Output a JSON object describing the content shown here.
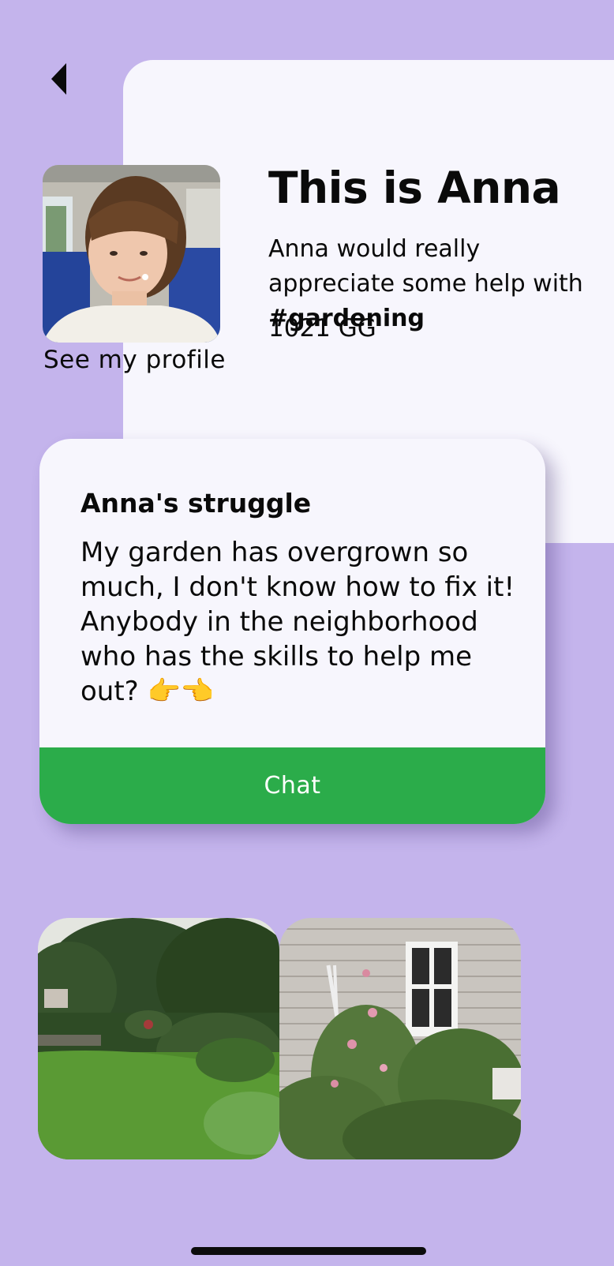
{
  "header": {
    "back_icon": "back-triangle-icon"
  },
  "profile": {
    "title": "This is Anna",
    "subtitle_prefix": "Anna would really appreciate some help with ",
    "subtitle_tag": "#gardening",
    "points": "1021 GG",
    "profile_link": "See my profile",
    "avatar_alt": "Anna"
  },
  "struggle": {
    "title": "Anna's struggle",
    "body": "My garden has overgrown so much, I don't know how to fix it! Anybody in the neighborhood who has the skills to help me out? 👉👈",
    "chat_label": "Chat"
  },
  "photos": [
    {
      "alt": "overgrown garden lawn"
    },
    {
      "alt": "house wall with window and climbing roses"
    }
  ],
  "colors": {
    "background": "#c4b4ec",
    "panel": "#f7f6fd",
    "accent_green": "#2bac4a"
  }
}
